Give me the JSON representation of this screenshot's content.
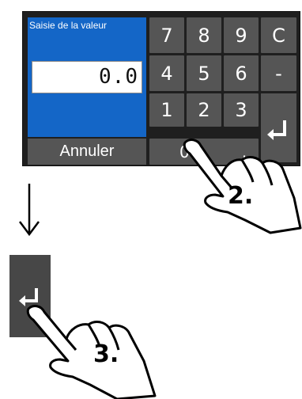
{
  "dialog": {
    "title": "Saisie de la valeur",
    "value": "0.0",
    "cancel_label": "Annuler"
  },
  "keypad": {
    "keys": [
      "7",
      "8",
      "9",
      "C",
      "4",
      "5",
      "6",
      "-",
      "1",
      "2",
      "3",
      "0",
      "."
    ]
  },
  "steps": {
    "step2": "2.",
    "step3": "3."
  },
  "colors": {
    "panel_blue": "#1466c7",
    "key_gray": "#555555",
    "frame_dark": "#1f1f1f"
  },
  "icons": [
    "enter-icon",
    "down-arrow-icon",
    "pointing-hand-icon"
  ]
}
